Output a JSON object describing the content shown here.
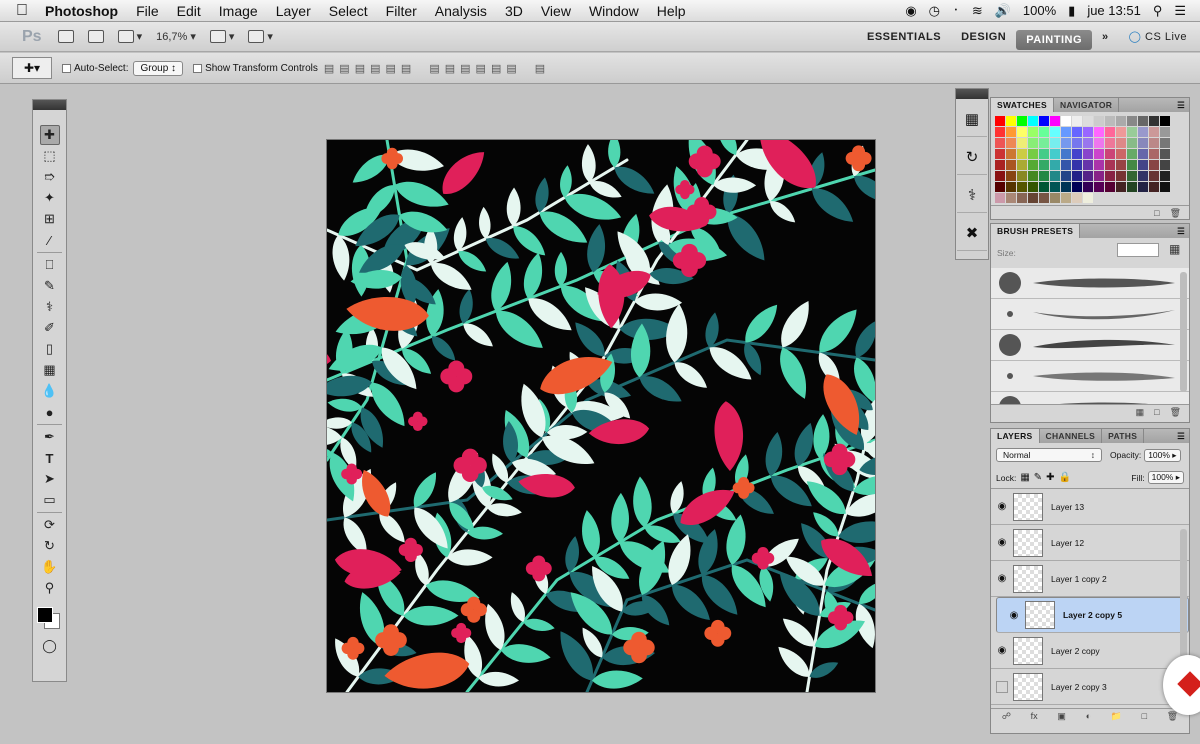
{
  "menubar": {
    "app": "Photoshop",
    "items": [
      "File",
      "Edit",
      "Image",
      "Layer",
      "Select",
      "Filter",
      "Analysis",
      "3D",
      "View",
      "Window",
      "Help"
    ],
    "battery": "100%",
    "clock": "jue 13:51"
  },
  "appbar": {
    "logo": "Ps",
    "zoom": "16,7%",
    "workspaces": [
      "ESSENTIALS",
      "DESIGN",
      "PAINTING"
    ],
    "active_workspace": "PAINTING",
    "cslive": "CS Live"
  },
  "options": {
    "auto_select_label": "Auto-Select:",
    "auto_select_value": "Group",
    "show_transform_label": "Show Transform Controls"
  },
  "panels": {
    "swatches_tabs": [
      "SWATCHES",
      "NAVIGATOR"
    ],
    "brush_tab": "BRUSH PRESETS",
    "brush_size_label": "Size:",
    "layers_tabs": [
      "LAYERS",
      "CHANNELS",
      "PATHS"
    ],
    "blend_mode": "Normal",
    "opacity_label": "Opacity:",
    "opacity_value": "100%",
    "lock_label": "Lock:",
    "fill_label": "Fill:",
    "fill_value": "100%",
    "layers": [
      {
        "name": "Layer 13",
        "visible": true,
        "selected": false
      },
      {
        "name": "Layer 12",
        "visible": true,
        "selected": false
      },
      {
        "name": "Layer 1 copy 2",
        "visible": true,
        "selected": false
      },
      {
        "name": "Layer 2 copy 5",
        "visible": true,
        "selected": true
      },
      {
        "name": "Layer 2 copy",
        "visible": true,
        "selected": false
      },
      {
        "name": "Layer 2 copy 3",
        "visible": false,
        "selected": false
      }
    ]
  },
  "colors": {
    "canvas_bg": "#050505",
    "leaf_mint": "#4fd6b0",
    "leaf_teal": "#1f6a70",
    "leaf_white": "#e6f6f0",
    "petal_pink": "#e0205a",
    "petal_orange": "#ee5a30"
  },
  "icons": {
    "apple": "apple-icon",
    "cslive": "cs-live-icon"
  }
}
